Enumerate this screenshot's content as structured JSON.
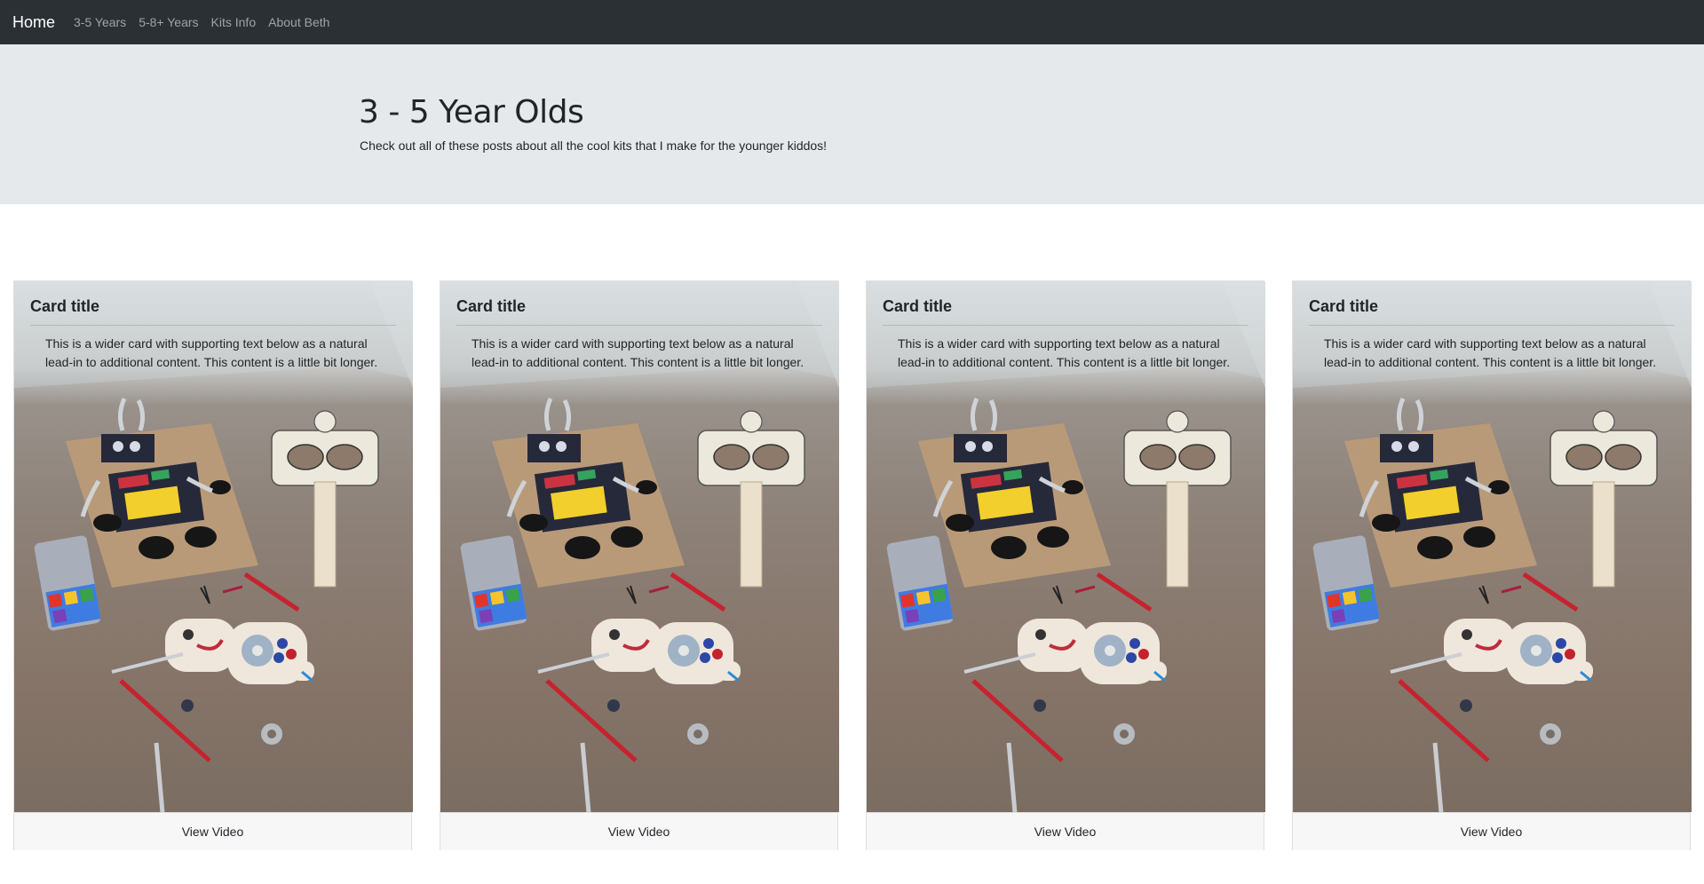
{
  "nav": {
    "brand": "Home",
    "links": [
      "3-5 Years",
      "5-8+ Years",
      "Kits Info",
      "About Beth"
    ]
  },
  "hero": {
    "title": "3 - 5 Year Olds",
    "subtitle": "Check out all of these posts about all the cool kits that I make for the younger kiddos!"
  },
  "cards": [
    {
      "title": "Card title",
      "text": "This is a wider card with supporting text below as a natural lead-in to additional content. This content is a little bit longer.",
      "footer": "View Video"
    },
    {
      "title": "Card title",
      "text": "This is a wider card with supporting text below as a natural lead-in to additional content. This content is a little bit longer.",
      "footer": "View Video"
    },
    {
      "title": "Card title",
      "text": "This is a wider card with supporting text below as a natural lead-in to additional content. This content is a little bit longer.",
      "footer": "View Video"
    },
    {
      "title": "Card title",
      "text": "This is a wider card with supporting text below as a natural lead-in to additional content. This content is a little bit longer.",
      "footer": "View Video"
    }
  ],
  "colors": {
    "navbar": "#2b3035",
    "hero": "#e6e9ec",
    "footer": "#f7f7f7"
  }
}
